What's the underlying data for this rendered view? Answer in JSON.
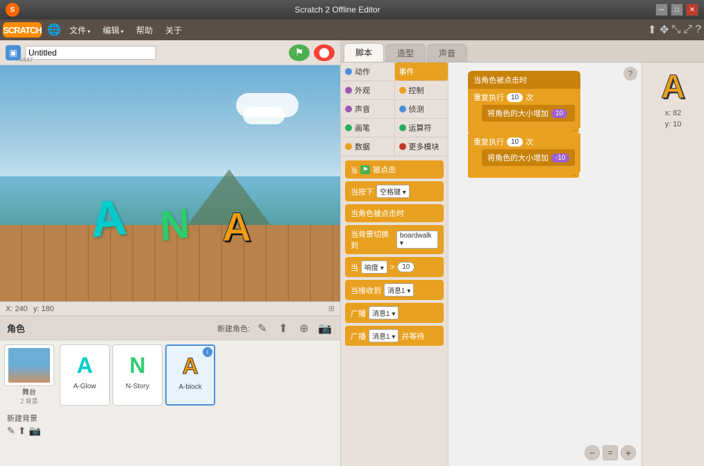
{
  "titlebar": {
    "title": "Scratch 2 Offline Editor",
    "min_label": "─",
    "max_label": "□",
    "close_label": "✕"
  },
  "menubar": {
    "logo": "SCRATCH",
    "globe_icon": "🌐",
    "file_label": "文件",
    "edit_label": "编辑",
    "help_label": "帮助",
    "about_label": "关于",
    "icons": [
      "⬆",
      "✥",
      "⤡",
      "⤢",
      "?"
    ]
  },
  "stage": {
    "title": "Untitled",
    "version": "v447",
    "coords_x": "X: 240",
    "coords_y": "y: 180"
  },
  "sprites": {
    "header": "角色",
    "new_label": "新建角色:",
    "items": [
      {
        "name": "A-Glow",
        "color": "#00cccc",
        "letter": "A",
        "selected": false
      },
      {
        "name": "N-Story",
        "color": "#2ecc71",
        "letter": "N",
        "selected": false
      },
      {
        "name": "A-block",
        "color": "#f39c12",
        "letter": "A",
        "selected": true
      }
    ],
    "stage_thumb_label": "舞台",
    "stage_thumb_sub": "2 背景",
    "new_bg_label": "新建背景",
    "new_bg_icons": [
      "✎",
      "⬆",
      "📷"
    ]
  },
  "tabs": {
    "items": [
      "脚本",
      "造型",
      "声音"
    ]
  },
  "block_categories": [
    {
      "left": "动作",
      "left_color": "#4a90d9",
      "right": "事件",
      "right_color": "#e8a020",
      "right_active": true
    },
    {
      "left": "外观",
      "left_color": "#9b59b6",
      "right": "控制",
      "right_color": "#e8a020",
      "right_active": false
    },
    {
      "left": "声音",
      "left_color": "#9b59b6",
      "right": "侦测",
      "right_color": "#4a90d9",
      "right_active": false
    },
    {
      "left": "画笔",
      "left_color": "#27ae60",
      "right": "运算符",
      "right_color": "#27ae60",
      "right_active": false
    },
    {
      "left": "数据",
      "left_color": "#e8a020",
      "right": "更多模块",
      "right_color": "#c0392b",
      "right_active": false
    }
  ],
  "block_list": [
    {
      "id": "when_clicked",
      "text": "当 🚩 被点击",
      "type": "orange"
    },
    {
      "id": "when_key",
      "text": "当按下 空格键 ▾",
      "type": "orange"
    },
    {
      "id": "when_sprite_clicked",
      "text": "当角色被点击时",
      "type": "orange"
    },
    {
      "id": "when_backdrop",
      "text": "当背景切换到 boardwalk ▾",
      "type": "orange"
    },
    {
      "id": "when_loud",
      "text": "当 响度 ▾ > 10",
      "type": "orange"
    },
    {
      "id": "when_msg",
      "text": "当接收到 消息1 ▾",
      "type": "orange"
    },
    {
      "id": "broadcast",
      "text": "广播 消息1 ▾",
      "type": "orange"
    },
    {
      "id": "broadcast_wait",
      "text": "广播 消息1 ▾ 并等待",
      "type": "orange"
    }
  ],
  "workspace_blocks": {
    "stack1_label": "当角色被点击时",
    "stack2_label": "重复执行",
    "stack2_count": "10",
    "stack2_count_suffix": "次",
    "stack3_label": "将角色的大小增加",
    "stack3_val": "10",
    "stack4_label": "重复执行",
    "stack4_count": "10",
    "stack4_count_suffix": "次",
    "stack5_label": "将角色的大小增加",
    "stack5_val": "-10"
  },
  "preview": {
    "letter": "A",
    "x": "x: 82",
    "y": "y: 10"
  }
}
